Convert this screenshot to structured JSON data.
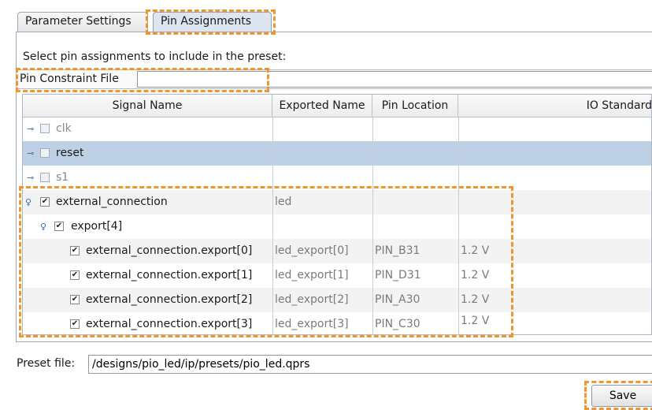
{
  "tabs": [
    {
      "label": "Parameter Settings"
    },
    {
      "label": "Pin Assignments"
    }
  ],
  "instructions": "Select pin assignments to include in the preset:",
  "pin_constraint": {
    "label": "Pin Constraint File",
    "value": ""
  },
  "table": {
    "columns": [
      "Signal Name",
      "Exported Name",
      "Pin Location",
      "IO Standard"
    ],
    "rows": [
      {
        "signal": "clk",
        "exported": "",
        "pin": "",
        "io": ""
      },
      {
        "signal": "reset",
        "exported": "",
        "pin": "",
        "io": ""
      },
      {
        "signal": "s1",
        "exported": "",
        "pin": "",
        "io": ""
      },
      {
        "signal": "external_connection",
        "exported": "led",
        "pin": "",
        "io": ""
      },
      {
        "signal": "export[4]",
        "exported": "",
        "pin": "",
        "io": ""
      },
      {
        "signal": "external_connection.export[0]",
        "exported": "led_export[0]",
        "pin": "PIN_B31",
        "io": "1.2 V"
      },
      {
        "signal": "external_connection.export[1]",
        "exported": "led_export[1]",
        "pin": "PIN_D31",
        "io": "1.2 V"
      },
      {
        "signal": "external_connection.export[2]",
        "exported": "led_export[2]",
        "pin": "PIN_A30",
        "io": "1.2 V"
      },
      {
        "signal": "external_connection.export[3]",
        "exported": "led_export[3]",
        "pin": "PIN_C30",
        "io": "1.2 V"
      }
    ]
  },
  "preset": {
    "label": "Preset file:",
    "value": "/designs/pio_led/ip/presets/pio_led.qprs"
  },
  "save_label": "Save",
  "colors": {
    "selection": "#bdd0e6",
    "highlight": "#f0962e",
    "tab_active": "#dce5f0"
  }
}
